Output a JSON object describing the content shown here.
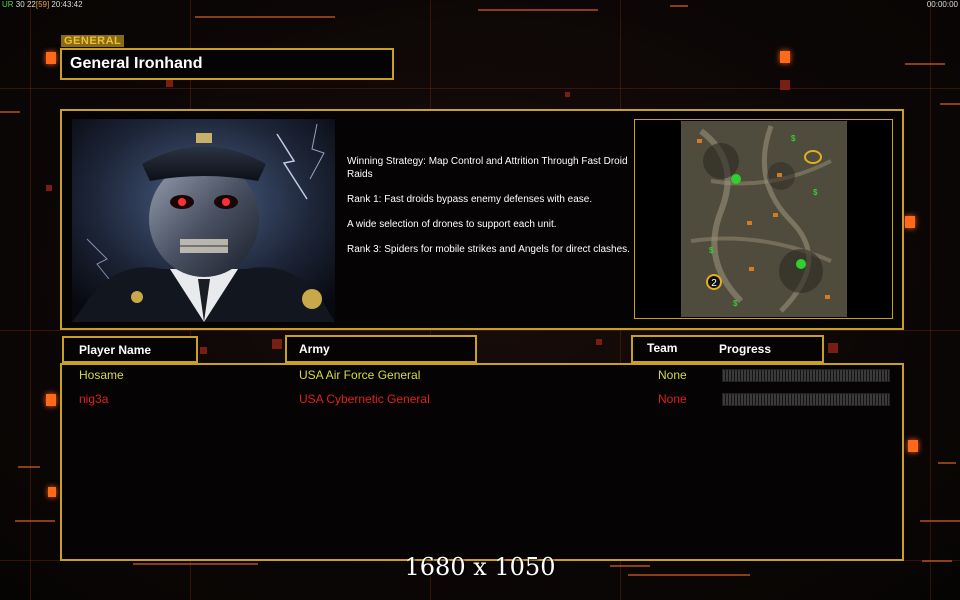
{
  "top_bar": {
    "left_prefix": "UR",
    "left_count": "30",
    "left_fps": "22",
    "left_fps_bracket": "[59]",
    "left_clock": "20:43:42",
    "right_clock": "00:00:00"
  },
  "general": {
    "tag": "GENERAL",
    "name": "General Ironhand"
  },
  "strategy": {
    "lines": [
      "Winning Strategy: Map Control and Attrition Through Fast Droid Raids",
      "Rank 1: Fast droids bypass enemy defenses with ease.",
      "A wide selection of drones to support each unit.",
      "Rank 3: Spiders for mobile strikes and Angels for direct clashes."
    ]
  },
  "minimap": {
    "player_marker_label": "2",
    "supply_label": "$"
  },
  "headers": {
    "player_name": "Player Name",
    "army": "Army",
    "team": "Team",
    "progress": "Progress"
  },
  "players": [
    {
      "name": "Hosame",
      "army": "USA Air Force General",
      "team": "None",
      "progress": 0,
      "color": "#d8d84a"
    },
    {
      "name": "nig3a",
      "army": "USA Cybernetic General",
      "team": "None",
      "progress": 0,
      "color": "#e02020"
    }
  ],
  "watermark": "1680 x 1050",
  "colors": {
    "accent": "#c9a122",
    "bg": "#050303"
  }
}
